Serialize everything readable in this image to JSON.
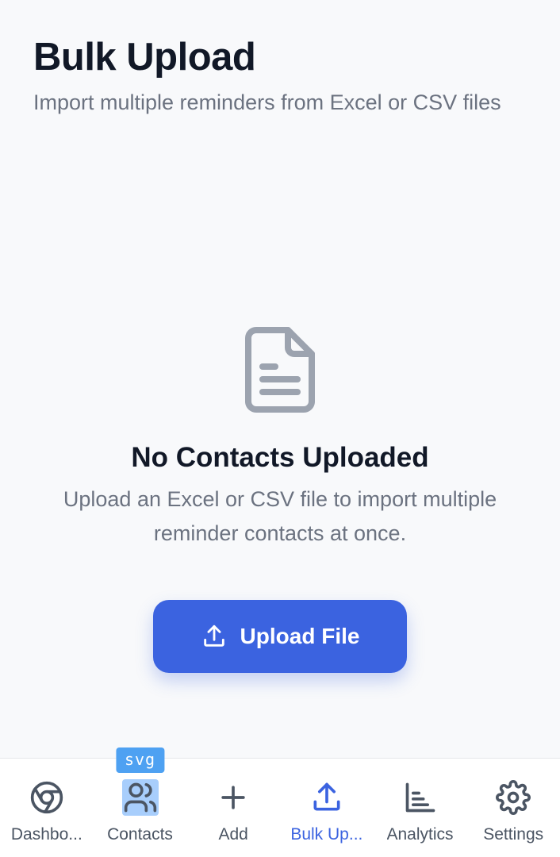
{
  "header": {
    "title": "Bulk Upload",
    "subtitle": "Import multiple reminders from Excel or CSV files"
  },
  "empty_state": {
    "icon": "document-icon",
    "title": "No Contacts Uploaded",
    "description": "Upload an Excel or CSV file to import multiple reminder contacts at once.",
    "button_label": "Upload File",
    "button_icon": "upload-icon"
  },
  "tabbar": {
    "overlay_tag": "svg",
    "active_tab": "Bulk Upload",
    "items": [
      {
        "label": "Dashbo...",
        "icon": "chrome-icon"
      },
      {
        "label": "Contacts",
        "icon": "contacts-icon"
      },
      {
        "label": "Add",
        "icon": "plus-icon"
      },
      {
        "label": "Bulk Up...",
        "icon": "upload-icon"
      },
      {
        "label": "Analytics",
        "icon": "bar-chart-icon"
      },
      {
        "label": "Settings",
        "icon": "gear-icon"
      }
    ]
  },
  "colors": {
    "accent": "#3b63e0",
    "background": "#f8f9fb",
    "text_primary": "#111827",
    "text_secondary": "#6b7280",
    "icon_gray": "#9ca3af",
    "highlight": "#4ea1f2"
  }
}
